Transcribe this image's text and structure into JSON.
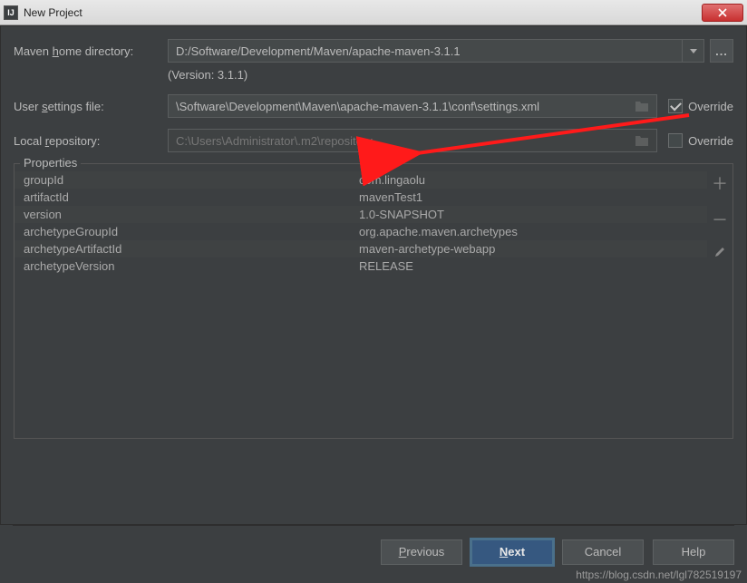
{
  "window": {
    "title": "New Project"
  },
  "form": {
    "maven_home_label_pre": "Maven ",
    "maven_home_label_m": "h",
    "maven_home_label_post": "ome directory:",
    "maven_home_value": "D:/Software/Development/Maven/apache-maven-3.1.1",
    "version_text": "(Version: 3.1.1)",
    "user_settings_label_pre": "User ",
    "user_settings_label_m": "s",
    "user_settings_label_post": "ettings file:",
    "user_settings_value": "\\Software\\Development\\Maven\\apache-maven-3.1.1\\conf\\settings.xml",
    "local_repo_label_pre": "Local ",
    "local_repo_label_m": "r",
    "local_repo_label_post": "epository:",
    "local_repo_value": "C:\\Users\\Administrator\\.m2\\repository",
    "override_label": "Override",
    "override_user_settings_checked": true,
    "override_local_repo_checked": false
  },
  "properties": {
    "title": "Properties",
    "rows": [
      {
        "key": "groupId",
        "value": "com.lingaolu"
      },
      {
        "key": "artifactId",
        "value": "mavenTest1"
      },
      {
        "key": "version",
        "value": "1.0-SNAPSHOT"
      },
      {
        "key": "archetypeGroupId",
        "value": "org.apache.maven.archetypes"
      },
      {
        "key": "archetypeArtifactId",
        "value": "maven-archetype-webapp"
      },
      {
        "key": "archetypeVersion",
        "value": "RELEASE"
      }
    ]
  },
  "buttons": {
    "previous_m": "P",
    "previous_rest": "revious",
    "next_m": "N",
    "next_rest": "ext",
    "cancel": "Cancel",
    "help": "Help"
  },
  "watermark": "https://blog.csdn.net/lgl782519197"
}
